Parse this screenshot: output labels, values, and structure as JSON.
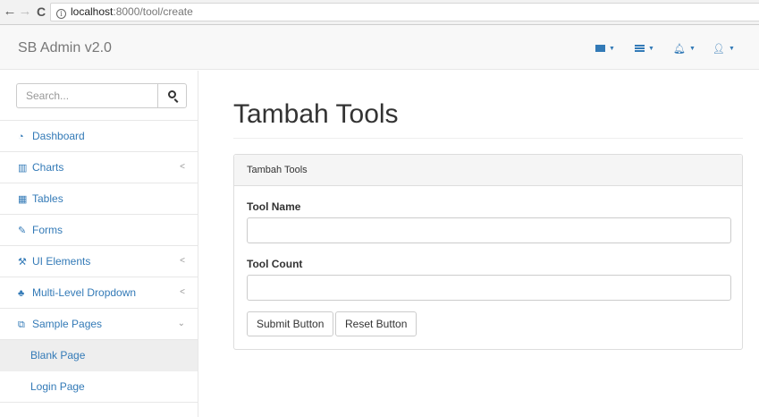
{
  "browser": {
    "url_host": "localhost",
    "url_path": ":8000/tool/create"
  },
  "navbar": {
    "brand": "SB Admin v2.0",
    "icons": [
      "envelope-icon",
      "tasks-icon",
      "bell-icon",
      "user-icon"
    ]
  },
  "sidebar": {
    "search_placeholder": "Search...",
    "items": [
      {
        "label": "Dashboard",
        "icon": "dashboard-icon"
      },
      {
        "label": "Charts",
        "icon": "bar-chart-icon",
        "arrow": "<"
      },
      {
        "label": "Tables",
        "icon": "table-icon"
      },
      {
        "label": "Forms",
        "icon": "edit-icon"
      },
      {
        "label": "UI Elements",
        "icon": "wrench-icon",
        "arrow": "<"
      },
      {
        "label": "Multi-Level Dropdown",
        "icon": "sitemap-icon",
        "arrow": "<"
      },
      {
        "label": "Sample Pages",
        "icon": "files-icon",
        "arrow": "⌄"
      }
    ],
    "subitems": [
      {
        "label": "Blank Page"
      },
      {
        "label": "Login Page"
      }
    ]
  },
  "main": {
    "page_title": "Tambah Tools",
    "panel_heading": "Tambah Tools",
    "tool_name_label": "Tool Name",
    "tool_name_value": "",
    "tool_count_label": "Tool Count",
    "tool_count_value": "",
    "submit_label": "Submit Button",
    "reset_label": "Reset Button"
  },
  "colors": {
    "link": "#337ab7",
    "navbar_bg": "#f8f8f8",
    "active_sub_bg": "#eeeeee"
  }
}
